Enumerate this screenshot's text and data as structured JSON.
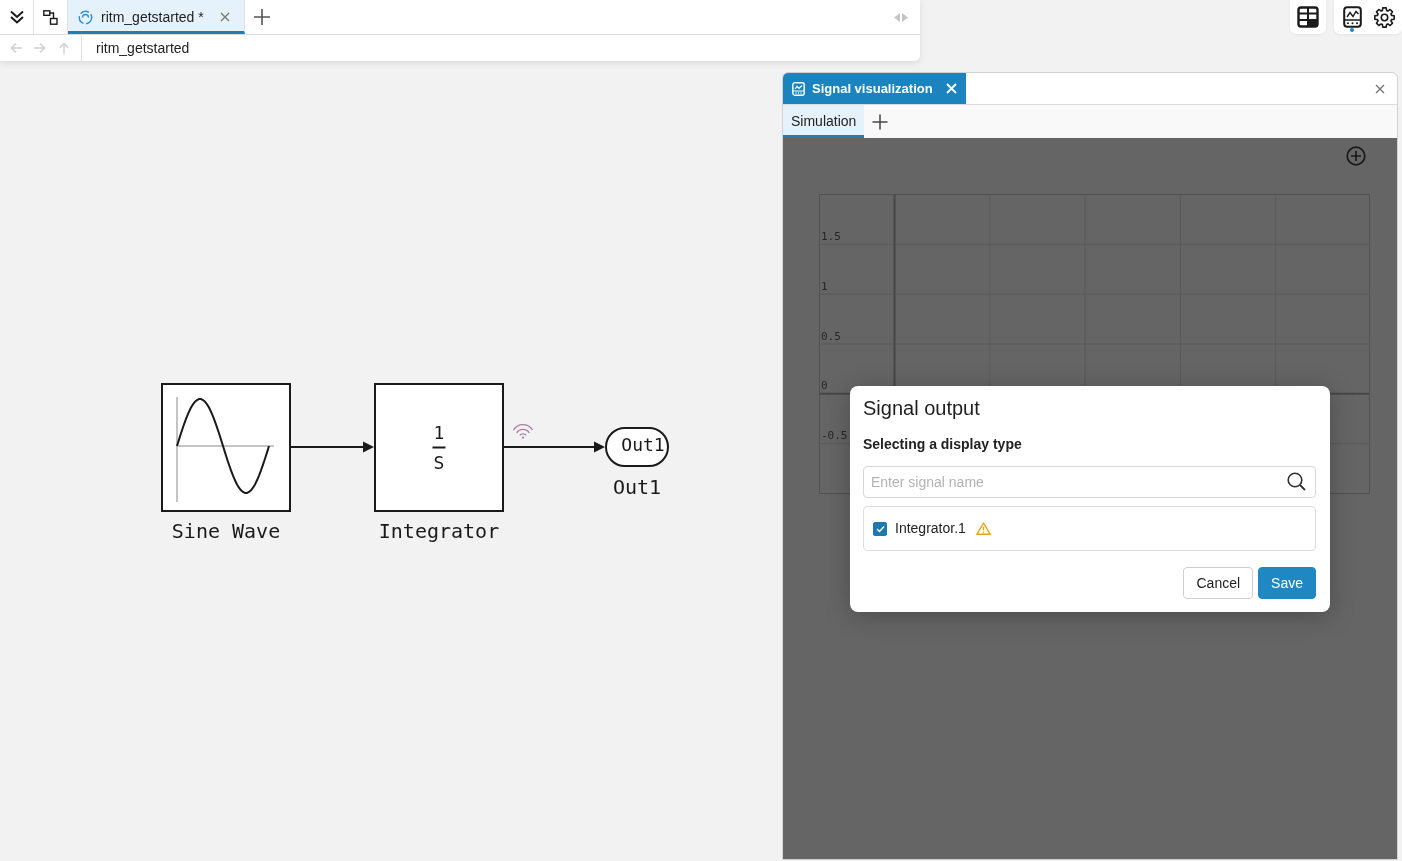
{
  "editor_tabs": [
    {
      "label": "ritm_getstarted *",
      "selected": true
    }
  ],
  "navigation": [
    {
      "kind": "back",
      "disabled": true
    },
    {
      "kind": "forward",
      "disabled": true
    },
    {
      "kind": "up",
      "disabled": true
    }
  ],
  "breadcrumb": [
    "ritm_getstarted"
  ],
  "side_toolbar": {
    "groups": [
      {
        "buttons": [
          {
            "kind": "layout",
            "active": false
          }
        ]
      },
      {
        "buttons": [
          {
            "kind": "signals",
            "active": true
          },
          {
            "kind": "settings",
            "active": false
          }
        ]
      }
    ]
  },
  "diagram": {
    "blocks": [
      {
        "kind": "sine",
        "label": "Sine Wave"
      },
      {
        "kind": "integrator",
        "numerator": "1",
        "denominator": "S",
        "label": "Integrator"
      },
      {
        "kind": "outport",
        "port_text": "Out1",
        "label": "Out1"
      }
    ],
    "lines": [
      {
        "logged": false
      },
      {
        "logged": true
      }
    ]
  },
  "signal_panel": {
    "tabs": [
      {
        "label": "Signal visualization",
        "selected": true
      }
    ],
    "subtabs": [
      {
        "label": "Simulation",
        "selected": true
      }
    ],
    "plot": {
      "y_labels": [
        "1.5",
        "1",
        "0.5",
        "0",
        "-0.5"
      ]
    }
  },
  "dialog": {
    "title": "Signal output",
    "subtitle": "Selecting a display type",
    "search": {
      "placeholder": "Enter signal name"
    },
    "signals": [
      {
        "name": "Integrator.1",
        "checked": true,
        "warning": true
      }
    ],
    "buttons": [
      {
        "label": "Cancel",
        "kind": "secondary"
      },
      {
        "label": "Save",
        "kind": "primary"
      }
    ]
  }
}
